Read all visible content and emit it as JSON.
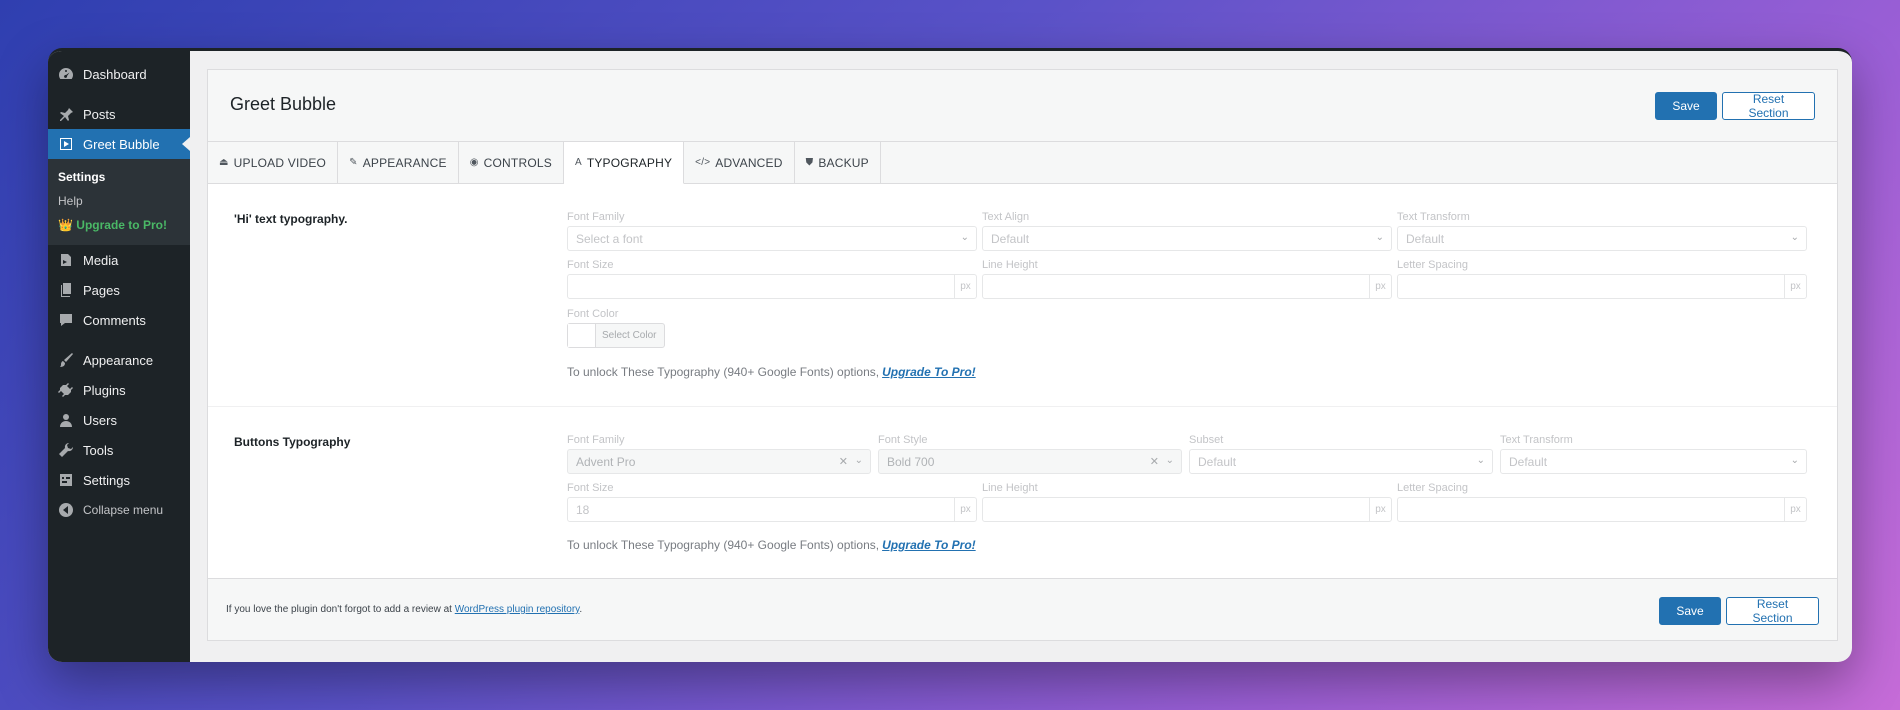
{
  "sidebar": {
    "items": [
      {
        "label": "Dashboard",
        "icon": "dashboard-icon"
      },
      {
        "label": "Posts",
        "icon": "pin-icon"
      },
      {
        "label": "Greet Bubble",
        "icon": "video-icon"
      },
      {
        "label": "Media",
        "icon": "media-icon"
      },
      {
        "label": "Pages",
        "icon": "pages-icon"
      },
      {
        "label": "Comments",
        "icon": "comment-icon"
      },
      {
        "label": "Appearance",
        "icon": "brush-icon"
      },
      {
        "label": "Plugins",
        "icon": "plugin-icon"
      },
      {
        "label": "Users",
        "icon": "user-icon"
      },
      {
        "label": "Tools",
        "icon": "wrench-icon"
      },
      {
        "label": "Settings",
        "icon": "settings-icon"
      }
    ],
    "submenu": {
      "settings": "Settings",
      "help": "Help",
      "upgrade": "Upgrade to Pro!"
    },
    "collapse": "Collapse menu"
  },
  "header": {
    "title": "Greet Bubble",
    "save": "Save",
    "reset": "Reset Section"
  },
  "tabs": [
    {
      "label": "UPLOAD VIDEO",
      "icon": "upload-icon"
    },
    {
      "label": "APPEARANCE",
      "icon": "brush-icon"
    },
    {
      "label": "CONTROLS",
      "icon": "eye-icon"
    },
    {
      "label": "TYPOGRAPHY",
      "icon": "typography-icon"
    },
    {
      "label": "ADVANCED",
      "icon": "code-icon"
    },
    {
      "label": "BACKUP",
      "icon": "shield-icon"
    }
  ],
  "active_tab": "TYPOGRAPHY",
  "hi_typography": {
    "title": "'Hi' text typography.",
    "font_family_label": "Font Family",
    "font_family_placeholder": "Select a font",
    "text_align_label": "Text Align",
    "text_align_value": "Default",
    "text_transform_label": "Text Transform",
    "text_transform_value": "Default",
    "font_size_label": "Font Size",
    "line_height_label": "Line Height",
    "letter_spacing_label": "Letter Spacing",
    "unit": "px",
    "font_color_label": "Font Color",
    "select_color": "Select Color",
    "unlock_text": "To unlock These Typography (940+ Google Fonts) options,",
    "unlock_link": "Upgrade To Pro!"
  },
  "buttons_typography": {
    "title": "Buttons Typography",
    "font_family_label": "Font Family",
    "font_family_value": "Advent Pro",
    "font_style_label": "Font Style",
    "font_style_value": "Bold 700",
    "subset_label": "Subset",
    "subset_value": "Default",
    "text_transform_label": "Text Transform",
    "text_transform_value": "Default",
    "font_size_label": "Font Size",
    "font_size_value": "18",
    "line_height_label": "Line Height",
    "letter_spacing_label": "Letter Spacing",
    "unit": "px",
    "unlock_text": "To unlock These Typography (940+ Google Fonts) options,",
    "unlock_link": "Upgrade To Pro!"
  },
  "footer": {
    "text": "If you love the plugin don't forgot to add a review at",
    "link": "WordPress plugin repository",
    "end": ".",
    "save": "Save",
    "reset": "Reset Section"
  },
  "colors": {
    "accent": "#2271b1",
    "sidebar_bg": "#1d2327",
    "pro_green": "#4ab866"
  }
}
